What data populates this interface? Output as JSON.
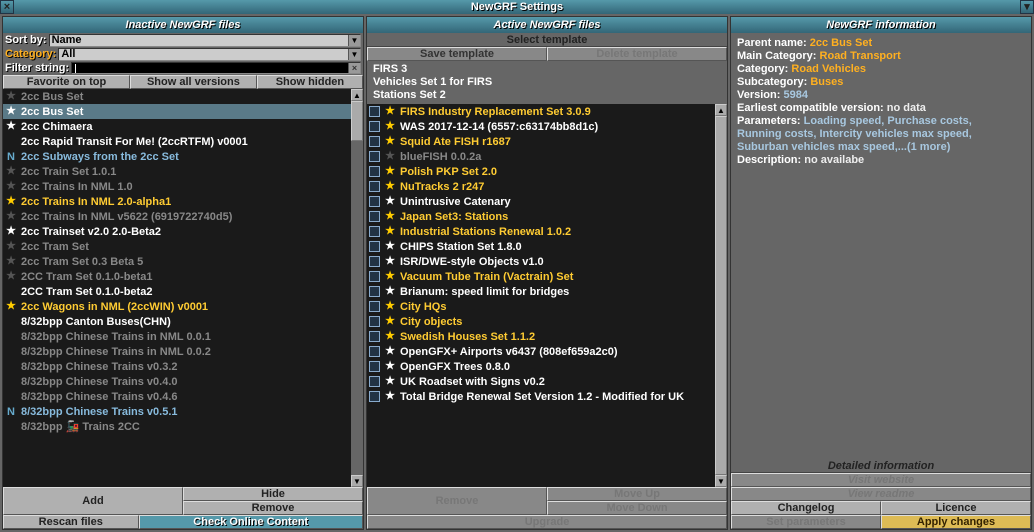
{
  "window": {
    "title": "NewGRF Settings"
  },
  "left": {
    "header": "Inactive NewGRF files",
    "sort_label": "Sort by:",
    "sort_value": "Name",
    "category_label": "Category:",
    "category_value": "All",
    "filter_label": "Filter string:",
    "filter_value": "",
    "fav": "Favorite on top",
    "show_versions": "Show all versions",
    "show_hidden": "Show hidden",
    "add": "Add",
    "hide": "Hide",
    "remove": "Remove",
    "rescan": "Rescan files",
    "check_online": "Check Online Content",
    "items": [
      {
        "icon": "star-dim",
        "text": "2cc Bus Set",
        "cls": "t-dim"
      },
      {
        "icon": "star-white",
        "text": "2cc Bus Set",
        "cls": "t-white",
        "selected": true
      },
      {
        "icon": "star-white",
        "text": "2cc Chimaera",
        "cls": "t-white"
      },
      {
        "icon": "none",
        "text": "2cc Rapid Transit For Me! (2ccRTFM) v0001",
        "cls": "t-white"
      },
      {
        "icon": "n",
        "text": "2cc Subways from the 2cc Set",
        "cls": "t-blue"
      },
      {
        "icon": "star-dim",
        "text": "2cc Train Set 1.0.1",
        "cls": "t-dim"
      },
      {
        "icon": "star-dim",
        "text": "2cc Trains In NML 1.0",
        "cls": "t-dim"
      },
      {
        "icon": "star-gold",
        "text": "2cc Trains In NML 2.0-alpha1",
        "cls": "t-gold"
      },
      {
        "icon": "star-dim",
        "text": "2cc Trains In NML v5622 (6919722740d5)",
        "cls": "t-dim"
      },
      {
        "icon": "star-white",
        "text": "2cc Trainset v2.0 2.0-Beta2",
        "cls": "t-white"
      },
      {
        "icon": "star-dim",
        "text": "2cc Tram Set",
        "cls": "t-dim"
      },
      {
        "icon": "star-dim",
        "text": "2cc Tram Set 0.3 Beta 5",
        "cls": "t-dim"
      },
      {
        "icon": "star-dim",
        "text": "2CC Tram Set 0.1.0-beta1",
        "cls": "t-dim"
      },
      {
        "icon": "none",
        "text": "2CC Tram Set 0.1.0-beta2",
        "cls": "t-white"
      },
      {
        "icon": "star-gold",
        "text": "2cc Wagons in NML (2ccWIN) v0001",
        "cls": "t-gold"
      },
      {
        "icon": "none",
        "text": "8/32bpp Canton Buses(CHN)",
        "cls": "t-white"
      },
      {
        "icon": "none",
        "text": "8/32bpp Chinese Trains in NML 0.0.1",
        "cls": "t-dim"
      },
      {
        "icon": "none",
        "text": "8/32bpp Chinese Trains in NML 0.0.2",
        "cls": "t-dim"
      },
      {
        "icon": "none",
        "text": "8/32bpp Chinese Trains v0.3.2",
        "cls": "t-dim"
      },
      {
        "icon": "none",
        "text": "8/32bpp Chinese Trains v0.4.0",
        "cls": "t-dim"
      },
      {
        "icon": "none",
        "text": "8/32bpp Chinese Trains v0.4.6",
        "cls": "t-dim"
      },
      {
        "icon": "n",
        "text": "8/32bpp Chinese Trains v0.5.1",
        "cls": "t-blue"
      },
      {
        "icon": "none",
        "text": "8/32bpp 🚂 Trains 2CC",
        "cls": "t-dim"
      }
    ]
  },
  "mid": {
    "header": "Active NewGRF files",
    "select_template": "Select template",
    "save_template": "Save template",
    "delete_template": "Delete template",
    "pre": [
      "FIRS 3",
      "Vehicles Set 1 for FIRS",
      "Stations Set 2"
    ],
    "remove": "Remove",
    "move_up": "Move Up",
    "move_down": "Move Down",
    "upgrade": "Upgrade",
    "items": [
      {
        "star": "gold",
        "text": "FIRS Industry Replacement Set 3.0.9",
        "cls": "t-gold"
      },
      {
        "star": "gold",
        "text": "WAS 2017-12-14 (6557:c63174bb8d1c)",
        "cls": "t-white"
      },
      {
        "star": "gold",
        "text": "Squid Ate FISH r1687",
        "cls": "t-gold"
      },
      {
        "star": "dim",
        "text": "blueFISH 0.0.2a",
        "cls": "t-dim"
      },
      {
        "star": "gold",
        "text": "Polish PKP Set 2.0",
        "cls": "t-gold"
      },
      {
        "star": "gold",
        "text": "NuTracks 2 r247",
        "cls": "t-gold"
      },
      {
        "star": "white",
        "text": "Unintrusive Catenary",
        "cls": "t-white"
      },
      {
        "star": "gold",
        "text": "Japan Set3: Stations",
        "cls": "t-gold"
      },
      {
        "star": "gold",
        "text": "Industrial Stations Renewal 1.0.2",
        "cls": "t-gold"
      },
      {
        "star": "white",
        "text": "CHIPS Station Set 1.8.0",
        "cls": "t-white"
      },
      {
        "star": "white",
        "text": "ISR/DWE-style Objects v1.0",
        "cls": "t-white"
      },
      {
        "star": "gold",
        "text": "Vacuum Tube Train (Vactrain) Set",
        "cls": "t-gold"
      },
      {
        "star": "white",
        "text": "Brianum: speed limit for bridges",
        "cls": "t-white"
      },
      {
        "star": "gold",
        "text": "City HQs",
        "cls": "t-gold"
      },
      {
        "star": "gold",
        "text": "City objects",
        "cls": "t-gold"
      },
      {
        "star": "gold",
        "text": "Swedish Houses Set 1.1.2",
        "cls": "t-gold"
      },
      {
        "star": "white",
        "text": "OpenGFX+ Airports v6437 (808ef659a2c0)",
        "cls": "t-white"
      },
      {
        "star": "white",
        "text": "OpenGFX Trees 0.8.0",
        "cls": "t-white"
      },
      {
        "star": "white",
        "text": "UK Roadset with Signs v0.2",
        "cls": "t-white"
      },
      {
        "star": "white",
        "text": "Total Bridge Renewal Set Version 1.2 - Modified for UK",
        "cls": "t-white"
      }
    ]
  },
  "right": {
    "header": "NewGRF information",
    "parent_name_k": "Parent name:",
    "parent_name_v": "2cc Bus Set",
    "main_cat_k": "Main Category:",
    "main_cat_v": "Road Transport",
    "cat_k": "Category:",
    "cat_v": "Road Vehicles",
    "subcat_k": "Subcategory:",
    "subcat_v": "Buses",
    "version_k": "Version:",
    "version_v": "5984",
    "compat_k": "Earliest compatible version:",
    "compat_v": "no data",
    "params_k": "Parameters:",
    "params_v1": "Loading speed, Purchase costs,",
    "params_v2": "Running costs, Intercity vehicles max speed,",
    "params_v3": "Suburban vehicles max speed,...(1 more)",
    "desc_k": "Description:",
    "desc_v": "no availabe",
    "detailed": "Detailed information",
    "visit": "Visit website",
    "readme": "View readme",
    "changelog": "Changelog",
    "licence": "Licence",
    "set_params": "Set parameters",
    "apply": "Apply changes"
  }
}
